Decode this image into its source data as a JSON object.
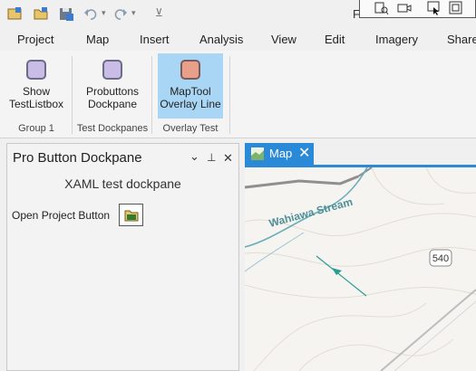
{
  "title_fragment": "F",
  "tabs": [
    "Project",
    "Map",
    "Insert",
    "Analysis",
    "View",
    "Edit",
    "Imagery",
    "Share"
  ],
  "ribbon": {
    "buttons": {
      "show": "Show\nTestListbox",
      "probuttons": "Probuttons\nDockpane",
      "maptool": "MapTool\nOverlay Line"
    },
    "groups": {
      "group1": "Group 1",
      "test_dockpanes": "Test Dockpanes",
      "overlay_test": "Overlay Test"
    }
  },
  "dockpane": {
    "title": "Pro Button Dockpane",
    "subtitle": "XAML test dockpane",
    "open_project_label": "Open Project Button",
    "controls": {
      "dropdown": "⌄",
      "pin": "⊥",
      "close": "✕"
    }
  },
  "map": {
    "tab_label": "Map",
    "tab_close": "✕",
    "labels": {
      "stream": "Wahiawa Stream",
      "route": "540"
    }
  },
  "colors": {
    "accent": "#2b8ad8",
    "selected_button": "#a9d6f5",
    "stream": "#69adb8",
    "arrow": "#2a9d8f"
  },
  "icons": [
    "new-project-icon",
    "open-project-icon",
    "save-project-icon",
    "undo-icon",
    "redo-icon",
    "customize-icon"
  ]
}
